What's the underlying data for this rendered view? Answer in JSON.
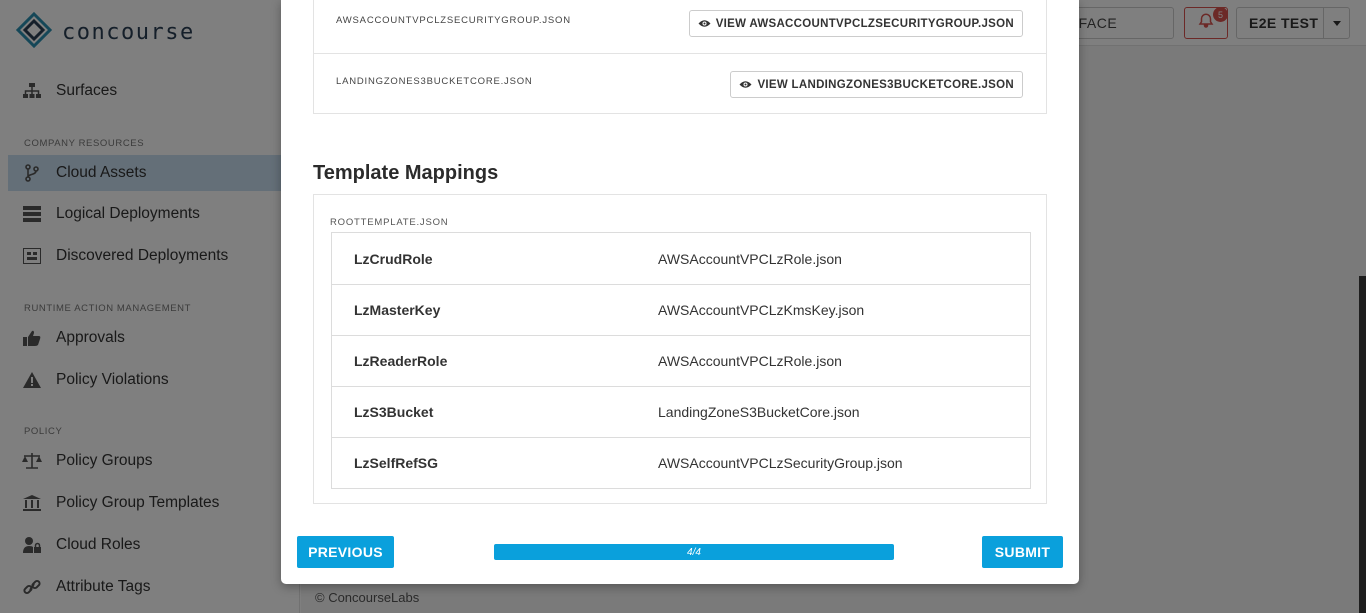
{
  "app": {
    "name": "concourse"
  },
  "sidebar": {
    "items": [
      {
        "label": "Surfaces",
        "icon": "sitemap-icon"
      },
      {
        "label": "Cloud Assets",
        "icon": "code-branch-icon",
        "active": true
      },
      {
        "label": "Logical Deployments",
        "icon": "server-icon"
      },
      {
        "label": "Discovered Deployments",
        "icon": "discover-icon"
      },
      {
        "label": "Approvals",
        "icon": "thumbs-up-icon"
      },
      {
        "label": "Policy Violations",
        "icon": "warning-icon"
      },
      {
        "label": "Policy Groups",
        "icon": "balance-scale-icon"
      },
      {
        "label": "Policy Group Templates",
        "icon": "institution-icon"
      },
      {
        "label": "Cloud Roles",
        "icon": "user-lock-icon"
      },
      {
        "label": "Attribute Tags",
        "icon": "link-icon"
      }
    ],
    "sections": {
      "company_resources": "COMPANY RESOURCES",
      "runtime_action_management": "RUNTIME ACTION MANAGEMENT",
      "policy": "POLICY"
    }
  },
  "header": {
    "surface_select": "RFACE",
    "notifications_count": "5",
    "user_name": "E2E TEST"
  },
  "footer": {
    "text": "© ConcourseLabs"
  },
  "modal": {
    "files": [
      {
        "name": "AWSACCOUNTVPCLZSECURITYGROUP.JSON",
        "button": "VIEW AWSACCOUNTVPCLZSECURITYGROUP.JSON"
      },
      {
        "name": "LANDINGZONES3BUCKETCORE.JSON",
        "button": "VIEW LANDINGZONES3BUCKETCORE.JSON"
      }
    ],
    "mappings_title": "Template Mappings",
    "root_template": "ROOTTEMPLATE.JSON",
    "mappings": [
      {
        "key": "LzCrudRole",
        "value": "AWSAccountVPCLzRole.json"
      },
      {
        "key": "LzMasterKey",
        "value": "AWSAccountVPCLzKmsKey.json"
      },
      {
        "key": "LzReaderRole",
        "value": "AWSAccountVPCLzRole.json"
      },
      {
        "key": "LzS3Bucket",
        "value": "LandingZoneS3BucketCore.json"
      },
      {
        "key": "LzSelfRefSG",
        "value": "AWSAccountVPCLzSecurityGroup.json"
      }
    ],
    "previous_label": "PREVIOUS",
    "submit_label": "SUBMIT",
    "progress_text": "4/4",
    "progress_value": 1.0
  },
  "colors": {
    "accent": "#0aa0dc",
    "danger": "#d9534f",
    "active_nav": "#c9dff0"
  }
}
